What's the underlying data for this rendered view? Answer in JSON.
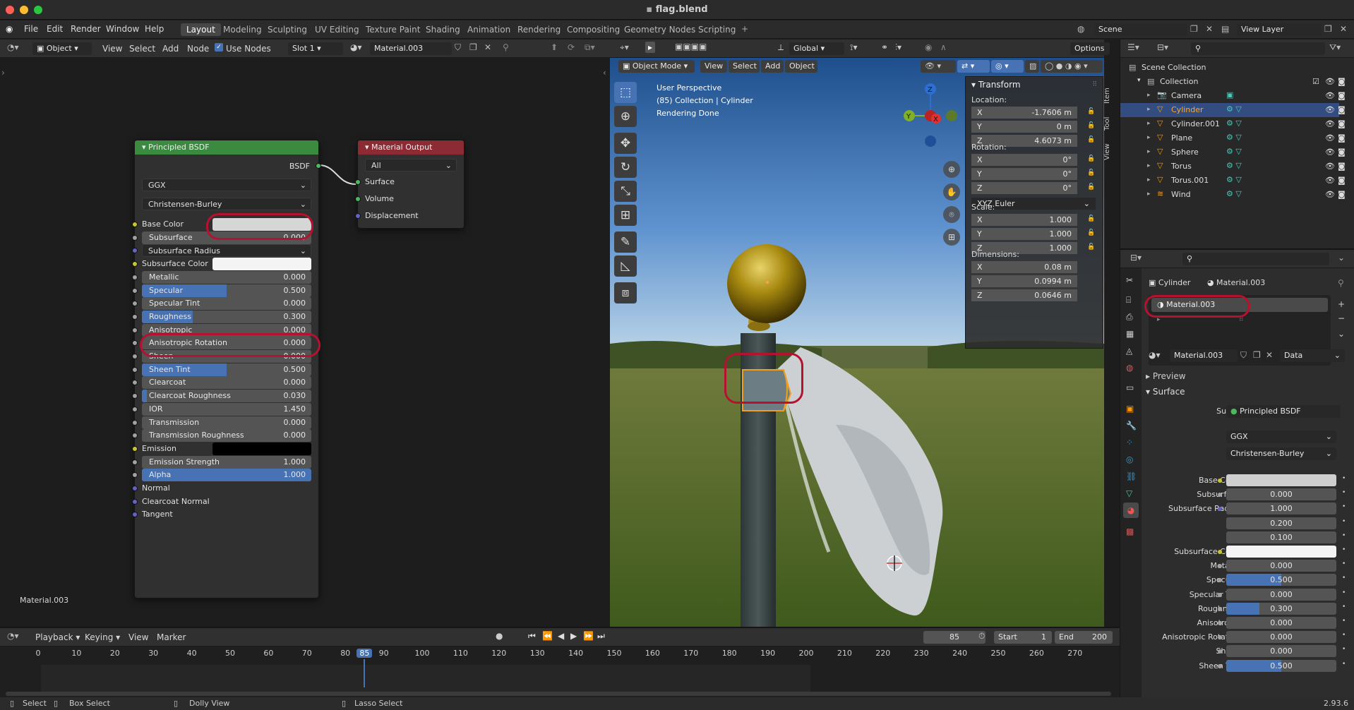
{
  "window": {
    "title": "flag.blend"
  },
  "menu": [
    "File",
    "Edit",
    "Render",
    "Window",
    "Help"
  ],
  "workspaces": [
    "Layout",
    "Modeling",
    "Sculpting",
    "UV Editing",
    "Texture Paint",
    "Shading",
    "Animation",
    "Rendering",
    "Compositing",
    "Geometry Nodes",
    "Scripting"
  ],
  "scene": {
    "name": "Scene",
    "view_layer": "View Layer"
  },
  "node_editor": {
    "header": {
      "mode": "Object",
      "menus": [
        "View",
        "Select",
        "Add",
        "Node"
      ],
      "use_nodes": "Use Nodes",
      "slot": "Slot 1",
      "material": "Material.003"
    },
    "bsdf": {
      "title": "Principled BSDF",
      "output": "BSDF",
      "distribution": "GGX",
      "subsurface_method": "Christensen-Burley",
      "rows": [
        {
          "label": "Base Color",
          "type": "color",
          "color": "#d6d6d6",
          "sock": "#c7c729"
        },
        {
          "label": "Subsurface",
          "value": "0.000",
          "fill": 0,
          "sock": "#a1a1a1"
        },
        {
          "label": "Subsurface Radius",
          "type": "drop",
          "sock": "#6363c7"
        },
        {
          "label": "Subsurface Color",
          "type": "color",
          "color": "#f4f4f4",
          "sock": "#c7c729"
        },
        {
          "label": "Metallic",
          "value": "0.000",
          "fill": 0,
          "sock": "#a1a1a1"
        },
        {
          "label": "Specular",
          "value": "0.500",
          "fill": 0.5,
          "sock": "#a1a1a1"
        },
        {
          "label": "Specular Tint",
          "value": "0.000",
          "fill": 0,
          "sock": "#a1a1a1"
        },
        {
          "label": "Roughness",
          "value": "0.300",
          "fill": 0.3,
          "sock": "#a1a1a1"
        },
        {
          "label": "Anisotropic",
          "value": "0.000",
          "fill": 0,
          "sock": "#a1a1a1"
        },
        {
          "label": "Anisotropic Rotation",
          "value": "0.000",
          "fill": 0,
          "sock": "#a1a1a1"
        },
        {
          "label": "Sheen",
          "value": "0.000",
          "fill": 0,
          "sock": "#a1a1a1"
        },
        {
          "label": "Sheen Tint",
          "value": "0.500",
          "fill": 0.5,
          "sock": "#a1a1a1"
        },
        {
          "label": "Clearcoat",
          "value": "0.000",
          "fill": 0,
          "sock": "#a1a1a1"
        },
        {
          "label": "Clearcoat Roughness",
          "value": "0.030",
          "fill": 0.03,
          "sock": "#a1a1a1"
        },
        {
          "label": "IOR",
          "value": "1.450",
          "fill": 0,
          "sock": "#a1a1a1"
        },
        {
          "label": "Transmission",
          "value": "0.000",
          "fill": 0,
          "sock": "#a1a1a1"
        },
        {
          "label": "Transmission Roughness",
          "value": "0.000",
          "fill": 0,
          "sock": "#a1a1a1"
        },
        {
          "label": "Emission",
          "type": "color",
          "color": "#000000",
          "sock": "#c7c729"
        },
        {
          "label": "Emission Strength",
          "value": "1.000",
          "fill": 0,
          "sock": "#a1a1a1"
        },
        {
          "label": "Alpha",
          "value": "1.000",
          "fill": 1,
          "sock": "#a1a1a1"
        },
        {
          "label": "Normal",
          "type": "plain",
          "sock": "#6363c7"
        },
        {
          "label": "Clearcoat Normal",
          "type": "plain",
          "sock": "#6363c7"
        },
        {
          "label": "Tangent",
          "type": "plain",
          "sock": "#6363c7"
        }
      ]
    },
    "output": {
      "title": "Material Output",
      "target": "All",
      "sockets": [
        "Surface",
        "Volume",
        "Displacement"
      ]
    },
    "footer_label": "Material.003"
  },
  "viewport": {
    "header": {
      "transform": "Global",
      "options": "Options",
      "mode": "Object Mode",
      "menus": [
        "View",
        "Select",
        "Add",
        "Object"
      ]
    },
    "overlay": [
      "User Perspective",
      "(85) Collection | Cylinder",
      "Rendering Done"
    ],
    "transform_panel": {
      "title": "Transform",
      "location_label": "Location:",
      "location": [
        "-1.7606 m",
        "0 m",
        "4.6073 m"
      ],
      "rotation_label": "Rotation:",
      "rotation": [
        "0°",
        "0°",
        "0°"
      ],
      "rotation_mode": "XYZ Euler",
      "scale_label": "Scale:",
      "scale": [
        "1.000",
        "1.000",
        "1.000"
      ],
      "dimensions_label": "Dimensions:",
      "dimensions": [
        "0.08 m",
        "0.0994 m",
        "0.0646 m"
      ],
      "axes": [
        "X",
        "Y",
        "Z"
      ]
    },
    "side_tabs": [
      "Item",
      "Tool",
      "View"
    ],
    "gizmo": {
      "x": "X",
      "y": "Y",
      "z": "Z"
    }
  },
  "outliner": {
    "root": "Scene Collection",
    "collection": "Collection",
    "items": [
      "Camera",
      "Cylinder",
      "Cylinder.001",
      "Plane",
      "Sphere",
      "Torus",
      "Torus.001",
      "Wind"
    ]
  },
  "properties": {
    "object": "Cylinder",
    "material": "Material.003",
    "slot": "Material.003",
    "data": "Data",
    "preview": "Preview",
    "surface_section": "Surface",
    "surface_label": "Surface",
    "surface_value": "Principled BSDF",
    "distribution": "GGX",
    "subsurface_method": "Christensen-Burley",
    "rows": [
      {
        "label": "Base Color",
        "type": "color",
        "color": "#cfcfcf",
        "dot": "#c7c729"
      },
      {
        "label": "Subsurface",
        "value": "0.000",
        "fill": 0,
        "dot": "#a1a1a1"
      },
      {
        "label": "Subsurface Radius",
        "value": "1.000",
        "fill": 0,
        "dot": "#6363c7"
      },
      {
        "label": "",
        "value": "0.200",
        "fill": 0,
        "dot": ""
      },
      {
        "label": "",
        "value": "0.100",
        "fill": 0,
        "dot": ""
      },
      {
        "label": "Subsurface Color",
        "type": "color",
        "color": "#f4f4f4",
        "dot": "#c7c729"
      },
      {
        "label": "Metallic",
        "value": "0.000",
        "fill": 0,
        "dot": "#a1a1a1"
      },
      {
        "label": "Specular",
        "value": "0.500",
        "fill": 0.5,
        "dot": "#a1a1a1"
      },
      {
        "label": "Specular Tint",
        "value": "0.000",
        "fill": 0,
        "dot": "#a1a1a1"
      },
      {
        "label": "Roughness",
        "value": "0.300",
        "fill": 0.3,
        "dot": "#a1a1a1"
      },
      {
        "label": "Anisotropic",
        "value": "0.000",
        "fill": 0,
        "dot": "#a1a1a1"
      },
      {
        "label": "Anisotropic Rotation",
        "value": "0.000",
        "fill": 0,
        "dot": "#a1a1a1"
      },
      {
        "label": "Sheen",
        "value": "0.000",
        "fill": 0,
        "dot": "#a1a1a1"
      },
      {
        "label": "Sheen Tint",
        "value": "0.500",
        "fill": 0.5,
        "dot": "#a1a1a1"
      }
    ]
  },
  "timeline": {
    "menus": [
      "Playback",
      "Keying",
      "View",
      "Marker"
    ],
    "current": "85",
    "start_label": "Start",
    "start": "1",
    "end_label": "End",
    "end": "200",
    "ticks": [
      "0",
      "10",
      "20",
      "30",
      "40",
      "50",
      "60",
      "70",
      "80",
      "85",
      "90",
      "100",
      "110",
      "120",
      "130",
      "140",
      "150",
      "160",
      "170",
      "180",
      "190",
      "200",
      "210",
      "220",
      "230",
      "240",
      "250",
      "260",
      "270"
    ]
  },
  "status": {
    "items": [
      "Select",
      "Box Select",
      "Dolly View",
      "Lasso Select"
    ],
    "version": "2.93.6"
  }
}
